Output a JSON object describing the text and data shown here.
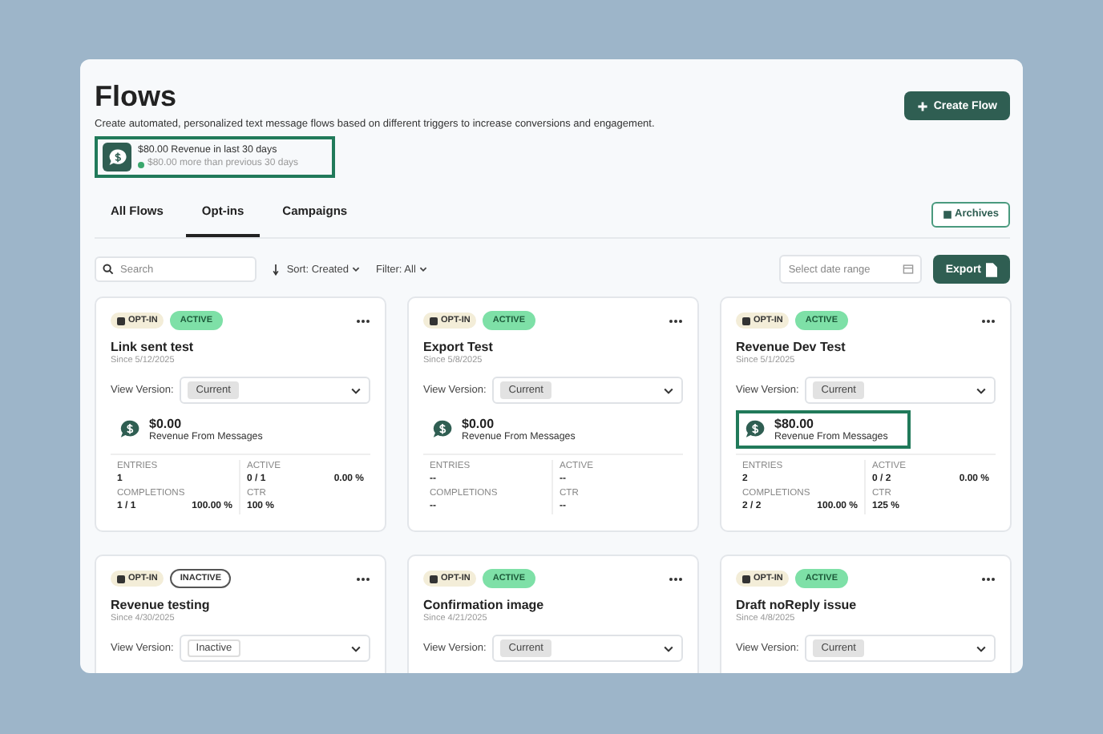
{
  "header": {
    "title": "Flows",
    "subtitle": "Create automated, personalized text message flows based on different triggers to increase conversions and engagement.",
    "create_button": "Create Flow"
  },
  "summary": {
    "revenue": "$80.00 Revenue in last 30 days",
    "change": "$80.00 more than previous 30 days",
    "highlighted": true
  },
  "tabs": [
    {
      "label": "All Flows",
      "selected": false
    },
    {
      "label": "Opt-ins",
      "selected": true
    },
    {
      "label": "Campaigns",
      "selected": false
    }
  ],
  "archives_button": "Archives",
  "toolbar": {
    "search_placeholder": "Search",
    "sort": "Sort: Created",
    "filter": "Filter: All",
    "date_placeholder": "Select date range",
    "export_button": "Export"
  },
  "cards": [
    {
      "type": "OPT-IN",
      "status": "ACTIVE",
      "active": true,
      "name": "Link sent test",
      "since": "Since 5/12/2025",
      "version_label": "View Version:",
      "version": "Current",
      "version_filled": true,
      "revenue": {
        "amount": "$0.00",
        "label": "Revenue From Messages",
        "highlighted": false
      },
      "stats": [
        {
          "label": "ENTRIES",
          "value": "1"
        },
        {
          "label": "ACTIVE",
          "value": "0 / 1",
          "percent": "0.00 %"
        },
        {
          "label": "COMPLETIONS",
          "value": "1 / 1",
          "percent": "100.00 %"
        },
        {
          "label": "CTR",
          "value": "100 %"
        }
      ]
    },
    {
      "type": "OPT-IN",
      "status": "ACTIVE",
      "active": true,
      "name": "Export Test",
      "since": "Since 5/8/2025",
      "version_label": "View Version:",
      "version": "Current",
      "version_filled": true,
      "revenue": {
        "amount": "$0.00",
        "label": "Revenue From Messages",
        "highlighted": false
      },
      "stats": [
        {
          "label": "ENTRIES",
          "value": "--"
        },
        {
          "label": "ACTIVE",
          "value": "--"
        },
        {
          "label": "COMPLETIONS",
          "value": "--"
        },
        {
          "label": "CTR",
          "value": "--"
        }
      ]
    },
    {
      "type": "OPT-IN",
      "status": "ACTIVE",
      "active": true,
      "name": "Revenue Dev Test",
      "since": "Since 5/1/2025",
      "version_label": "View Version:",
      "version": "Current",
      "version_filled": true,
      "revenue": {
        "amount": "$80.00",
        "label": "Revenue From Messages",
        "highlighted": true
      },
      "stats": [
        {
          "label": "ENTRIES",
          "value": "2"
        },
        {
          "label": "ACTIVE",
          "value": "0 / 2",
          "percent": "0.00 %"
        },
        {
          "label": "COMPLETIONS",
          "value": "2 / 2",
          "percent": "100.00 %"
        },
        {
          "label": "CTR",
          "value": "125 %"
        }
      ]
    },
    {
      "type": "OPT-IN",
      "status": "INACTIVE",
      "active": false,
      "name": "Revenue testing",
      "since": "Since 4/30/2025",
      "version_label": "View Version:",
      "version": "Inactive",
      "version_filled": false
    },
    {
      "type": "OPT-IN",
      "status": "ACTIVE",
      "active": true,
      "name": "Confirmation image",
      "since": "Since 4/21/2025",
      "version_label": "View Version:",
      "version": "Current",
      "version_filled": true
    },
    {
      "type": "OPT-IN",
      "status": "ACTIVE",
      "active": true,
      "name": "Draft noReply issue",
      "since": "Since 4/8/2025",
      "version_label": "View Version:",
      "version": "Current",
      "version_filled": true
    }
  ]
}
